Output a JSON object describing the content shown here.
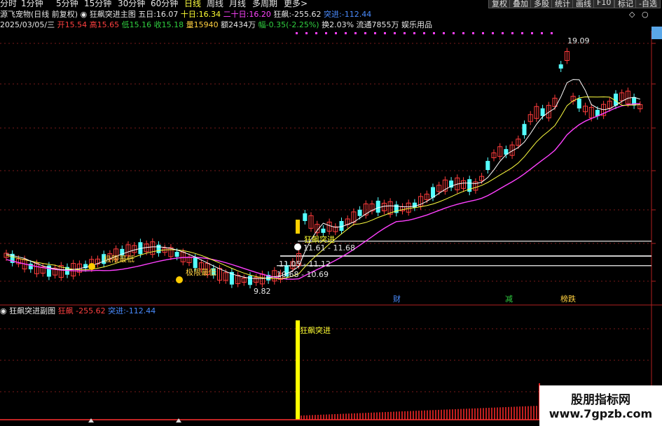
{
  "topbar": {
    "periods": [
      "分时",
      "1分钟",
      "5分钟",
      "15分钟",
      "30分钟",
      "60分钟",
      "日线",
      "周线",
      "月线",
      "多周期",
      "更多>"
    ],
    "right_buttons": [
      "复权",
      "叠加",
      "多股",
      "统计",
      "画线",
      "F10",
      "标记",
      "-自选"
    ]
  },
  "main_header": {
    "stock_name": "源飞宠物(日线 前复权)",
    "indicator_name": "狂飙突进主图",
    "ma5_label": "五日:",
    "ma5_value": "16.07",
    "ma10_label": "十日:",
    "ma10_value": "16.34",
    "ma20_label": "二十日:",
    "ma20_value": "16.20",
    "kb_label": "狂飙:",
    "kb_value": "-255.62",
    "tj_label": "突进:",
    "tj_value": "-112.44",
    "window_icons": [
      "diamond-icon",
      "circle-icon"
    ]
  },
  "quote": {
    "date": "2025/03/05/三",
    "open_label": "开",
    "open": "15.54",
    "high_label": "高",
    "high": "15.65",
    "low_label": "低",
    "low": "15.16",
    "close_label": "收",
    "close": "15.18",
    "vol_label": "量",
    "vol": "15940",
    "amount_label": "额",
    "amount": "2434万",
    "change_label": "幅",
    "change": "-0.35(-2.25%)",
    "turnover_label": "换",
    "turnover": "2.03%",
    "float_label": "流通",
    "float": "7855万",
    "sector": "娱乐用品"
  },
  "chart_annotations": {
    "high_label": "19.09",
    "low_label": "9.82",
    "breakout_label": "狂飙突进",
    "level_1": "11.61 - 11.68",
    "level_2": "11.05 - 11.12",
    "level_3": "10.68 - 10.69",
    "mark_1": "极限最低",
    "mark_2": "极限最低",
    "news_tags": [
      "财",
      "减",
      "榜跌"
    ]
  },
  "sub_header": {
    "indicator_name": "狂飙突进副图",
    "kb_label": "狂飙",
    "kb_value": "-255.62",
    "tj_label": "突进:",
    "tj_value": "-112.44",
    "signal_label": "狂飙突进"
  },
  "watermark": {
    "line1": "股朋指标网",
    "line2": "www.7gpzb.com"
  },
  "colors": {
    "up": "#ff3c3c",
    "down": "#54ffff",
    "ma5": "#ffffff",
    "ma10": "#ffff40",
    "ma20": "#ff40ff",
    "signal": "#ffff00",
    "grid": "#7a1a1a"
  }
}
